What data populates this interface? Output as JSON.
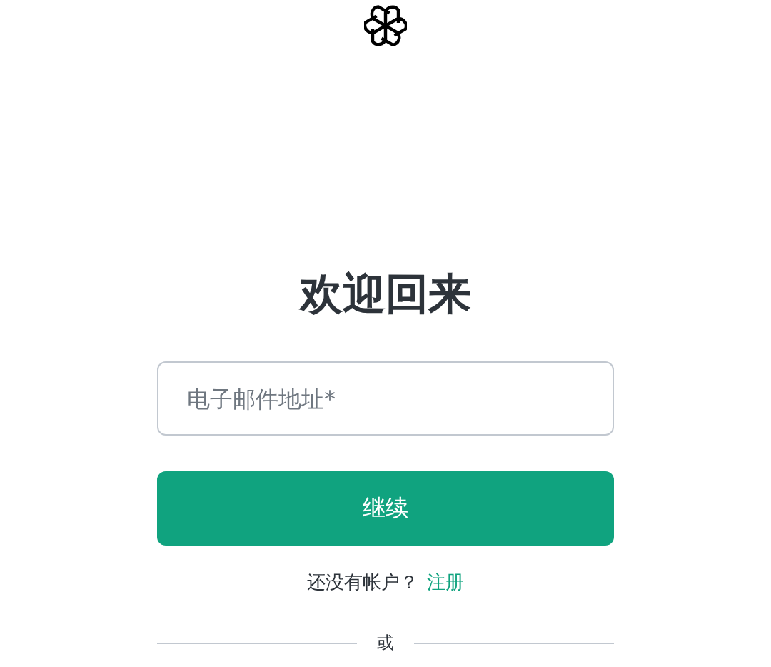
{
  "title": "欢迎回来",
  "email_field": {
    "placeholder": "电子邮件地址*"
  },
  "continue_button": {
    "label": "继续"
  },
  "signup_prompt": {
    "text": "还没有帐户？",
    "link": "注册"
  },
  "divider": {
    "label": "或"
  }
}
